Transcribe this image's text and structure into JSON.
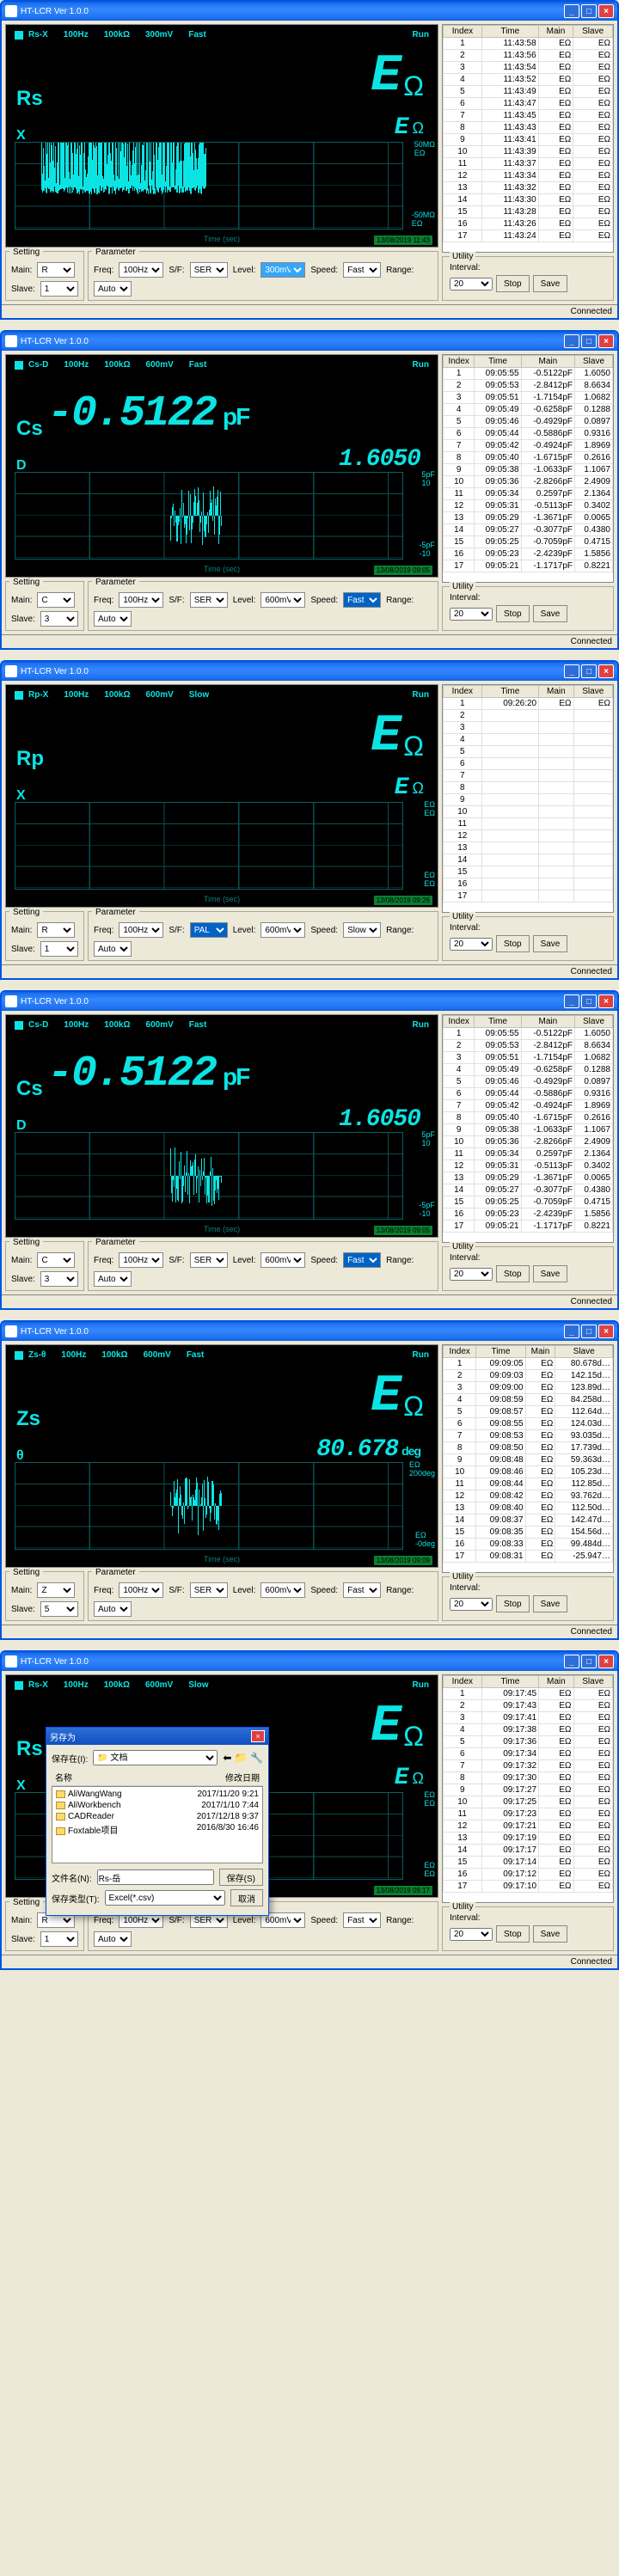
{
  "app_title": "HT-LCR Ver 1.0.0",
  "status_text": "Connected",
  "labels": {
    "setting": "Setting",
    "parameter": "Parameter",
    "utility": "Utility",
    "main": "Main:",
    "slave": "Slave:",
    "freq": "Freq:",
    "sf": "S/F:",
    "level": "Level:",
    "speed": "Speed:",
    "range": "Range:",
    "interval": "Interval:",
    "stop": "Stop",
    "save": "Save",
    "run": "Run",
    "time_axis": "Time (sec)"
  },
  "titlebar_btns": {
    "min": "_",
    "max": "□",
    "close": "×"
  },
  "table_headers": [
    "Index",
    "Time",
    "Main",
    "Slave"
  ],
  "windows": [
    {
      "header": {
        "mode": "Rs-X",
        "freq": "100Hz",
        "imp": "100kΩ",
        "level": "300mV",
        "speed": "Fast"
      },
      "main_label": "Rs",
      "main_value": "E",
      "main_unit": "Ω",
      "sec_label": "X",
      "sec_value": "E",
      "sec_unit": "Ω",
      "y_top": "50MΩ",
      "y_top_sub": "EΩ",
      "y_bot": "-50MΩ",
      "y_bot_sub": "EΩ",
      "ts": "13/08/2019 11:43",
      "noise_dense": true,
      "setting": {
        "main": "R",
        "slave": "1"
      },
      "param": {
        "freq": "100Hz",
        "sf": "SER",
        "level": "300mV",
        "level_hl": true,
        "speed": "Fast",
        "range": "Auto"
      },
      "interval": "20",
      "rows": [
        [
          "1",
          "11:43:58",
          "EΩ",
          "EΩ"
        ],
        [
          "2",
          "11:43:56",
          "EΩ",
          "EΩ"
        ],
        [
          "3",
          "11:43:54",
          "EΩ",
          "EΩ"
        ],
        [
          "4",
          "11:43:52",
          "EΩ",
          "EΩ"
        ],
        [
          "5",
          "11:43:49",
          "EΩ",
          "EΩ"
        ],
        [
          "6",
          "11:43:47",
          "EΩ",
          "EΩ"
        ],
        [
          "7",
          "11:43:45",
          "EΩ",
          "EΩ"
        ],
        [
          "8",
          "11:43:43",
          "EΩ",
          "EΩ"
        ],
        [
          "9",
          "11:43:41",
          "EΩ",
          "EΩ"
        ],
        [
          "10",
          "11:43:39",
          "EΩ",
          "EΩ"
        ],
        [
          "11",
          "11:43:37",
          "EΩ",
          "EΩ"
        ],
        [
          "12",
          "11:43:34",
          "EΩ",
          "EΩ"
        ],
        [
          "13",
          "11:43:32",
          "EΩ",
          "EΩ"
        ],
        [
          "14",
          "11:43:30",
          "EΩ",
          "EΩ"
        ],
        [
          "15",
          "11:43:28",
          "EΩ",
          "EΩ"
        ],
        [
          "16",
          "11:43:26",
          "EΩ",
          "EΩ"
        ],
        [
          "17",
          "11:43:24",
          "EΩ",
          "EΩ"
        ]
      ]
    },
    {
      "header": {
        "mode": "Cs-D",
        "freq": "100Hz",
        "imp": "100kΩ",
        "level": "600mV",
        "speed": "Fast"
      },
      "main_label": "Cs",
      "main_bigvalue": "-0.5122",
      "main_unit": "pF",
      "sec_label": "D",
      "sec_bigvalue": "1.6050",
      "y_top": "5pF",
      "y_top_sub": "10",
      "y_bot": "-5pF",
      "y_bot_sub": "-10",
      "ts": "13/08/2019 09:05",
      "noise_spike": true,
      "setting": {
        "main": "C",
        "slave": "3"
      },
      "param": {
        "freq": "100Hz",
        "sf": "SER",
        "level": "600mV",
        "speed": "Fast",
        "speed_hl": true,
        "range": "Auto"
      },
      "interval": "20",
      "rows": [
        [
          "1",
          "09:05:55",
          "-0.5122pF",
          "1.6050"
        ],
        [
          "2",
          "09:05:53",
          "-2.8412pF",
          "8.6634"
        ],
        [
          "3",
          "09:05:51",
          "-1.7154pF",
          "1.0682"
        ],
        [
          "4",
          "09:05:49",
          "-0.6258pF",
          "0.1288"
        ],
        [
          "5",
          "09:05:46",
          "-0.4929pF",
          "0.0897"
        ],
        [
          "6",
          "09:05:44",
          "-0.5886pF",
          "0.9316"
        ],
        [
          "7",
          "09:05:42",
          "-0.4924pF",
          "1.8969"
        ],
        [
          "8",
          "09:05:40",
          "-1.6715pF",
          "0.2616"
        ],
        [
          "9",
          "09:05:38",
          "-1.0633pF",
          "1.1067"
        ],
        [
          "10",
          "09:05:36",
          "-2.8266pF",
          "2.4909"
        ],
        [
          "11",
          "09:05:34",
          "0.2597pF",
          "2.1364"
        ],
        [
          "12",
          "09:05:31",
          "-0.5113pF",
          "0.3402"
        ],
        [
          "13",
          "09:05:29",
          "-1.3671pF",
          "0.0065"
        ],
        [
          "14",
          "09:05:27",
          "-0.3077pF",
          "0.4380"
        ],
        [
          "15",
          "09:05:25",
          "-0.7059pF",
          "0.4715"
        ],
        [
          "16",
          "09:05:23",
          "-2.4239pF",
          "1.5856"
        ],
        [
          "17",
          "09:05:21",
          "-1.1717pF",
          "0.8221"
        ]
      ]
    },
    {
      "header": {
        "mode": "Rp-X",
        "freq": "100Hz",
        "imp": "100kΩ",
        "level": "600mV",
        "speed": "Slow"
      },
      "main_label": "Rp",
      "main_value": "E",
      "main_unit": "Ω",
      "sec_label": "X",
      "sec_value": "E",
      "sec_unit": "Ω",
      "y_top": "EΩ",
      "y_top_sub": "EΩ",
      "y_bot": "EΩ",
      "y_bot_sub": "EΩ",
      "ts": "13/08/2019 09:26",
      "noise_dense": false,
      "setting": {
        "main": "R",
        "slave": "1"
      },
      "param": {
        "freq": "100Hz",
        "sf": "PAL",
        "sf_hl": true,
        "level": "600mV",
        "speed": "Slow",
        "range": "Auto",
        "range_dropdown": true
      },
      "interval": "20",
      "rows": [
        [
          "1",
          "09:26:20",
          "EΩ",
          "EΩ"
        ],
        [
          "2",
          "",
          "",
          ""
        ],
        [
          "3",
          "",
          "",
          ""
        ],
        [
          "4",
          "",
          "",
          ""
        ],
        [
          "5",
          "",
          "",
          ""
        ],
        [
          "6",
          "",
          "",
          ""
        ],
        [
          "7",
          "",
          "",
          ""
        ],
        [
          "8",
          "",
          "",
          ""
        ],
        [
          "9",
          "",
          "",
          ""
        ],
        [
          "10",
          "",
          "",
          ""
        ],
        [
          "11",
          "",
          "",
          ""
        ],
        [
          "12",
          "",
          "",
          ""
        ],
        [
          "13",
          "",
          "",
          ""
        ],
        [
          "14",
          "",
          "",
          ""
        ],
        [
          "15",
          "",
          "",
          ""
        ],
        [
          "16",
          "",
          "",
          ""
        ],
        [
          "17",
          "",
          "",
          ""
        ]
      ]
    },
    {
      "header": {
        "mode": "Cs-D",
        "freq": "100Hz",
        "imp": "100kΩ",
        "level": "600mV",
        "speed": "Fast"
      },
      "main_label": "Cs",
      "main_bigvalue": "-0.5122",
      "main_unit": "pF",
      "sec_label": "D",
      "sec_bigvalue": "1.6050",
      "y_top": "5pF",
      "y_top_sub": "10",
      "y_bot": "-5pF",
      "y_bot_sub": "-10",
      "ts": "13/08/2019 09:05",
      "noise_spike": true,
      "setting": {
        "main": "C",
        "slave": "3"
      },
      "param": {
        "freq": "100Hz",
        "sf": "SER",
        "level": "600mV",
        "speed": "Fast",
        "speed_hl": true,
        "range": "Auto"
      },
      "interval": "20",
      "rows": [
        [
          "1",
          "09:05:55",
          "-0.5122pF",
          "1.6050"
        ],
        [
          "2",
          "09:05:53",
          "-2.8412pF",
          "8.6634"
        ],
        [
          "3",
          "09:05:51",
          "-1.7154pF",
          "1.0682"
        ],
        [
          "4",
          "09:05:49",
          "-0.6258pF",
          "0.1288"
        ],
        [
          "5",
          "09:05:46",
          "-0.4929pF",
          "0.0897"
        ],
        [
          "6",
          "09:05:44",
          "-0.5886pF",
          "0.9316"
        ],
        [
          "7",
          "09:05:42",
          "-0.4924pF",
          "1.8969"
        ],
        [
          "8",
          "09:05:40",
          "-1.6715pF",
          "0.2616"
        ],
        [
          "9",
          "09:05:38",
          "-1.0633pF",
          "1.1067"
        ],
        [
          "10",
          "09:05:36",
          "-2.8266pF",
          "2.4909"
        ],
        [
          "11",
          "09:05:34",
          "0.2597pF",
          "2.1364"
        ],
        [
          "12",
          "09:05:31",
          "-0.5113pF",
          "0.3402"
        ],
        [
          "13",
          "09:05:29",
          "-1.3671pF",
          "0.0065"
        ],
        [
          "14",
          "09:05:27",
          "-0.3077pF",
          "0.4380"
        ],
        [
          "15",
          "09:05:25",
          "-0.7059pF",
          "0.4715"
        ],
        [
          "16",
          "09:05:23",
          "-2.4239pF",
          "1.5856"
        ],
        [
          "17",
          "09:05:21",
          "-1.1717pF",
          "0.8221"
        ]
      ]
    },
    {
      "header": {
        "mode": "Zs-θ",
        "freq": "100Hz",
        "imp": "100kΩ",
        "level": "600mV",
        "speed": "Fast"
      },
      "main_label": "Zs",
      "main_value": "E",
      "main_unit": "Ω",
      "sec_label": "θ",
      "sec_bigvalue": "80.678",
      "sec_bigunit": "deg",
      "y_top": "EΩ",
      "y_top_sub": "200deg",
      "y_bot": "EΩ",
      "y_bot_sub": "-0deg",
      "ts": "13/08/2019 09:09",
      "noise_spike": true,
      "setting": {
        "main": "Z",
        "slave": "5"
      },
      "param": {
        "freq": "100Hz",
        "sf": "SER",
        "level": "600mV",
        "speed": "Fast",
        "range": "Auto"
      },
      "interval": "20",
      "rows": [
        [
          "1",
          "09:09:05",
          "EΩ",
          "80.678d…"
        ],
        [
          "2",
          "09:09:03",
          "EΩ",
          "142.15d…"
        ],
        [
          "3",
          "09:09:00",
          "EΩ",
          "123.89d…"
        ],
        [
          "4",
          "09:08:59",
          "EΩ",
          "84.258d…"
        ],
        [
          "5",
          "09:08:57",
          "EΩ",
          "112.64d…"
        ],
        [
          "6",
          "09:08:55",
          "EΩ",
          "124.03d…"
        ],
        [
          "7",
          "09:08:53",
          "EΩ",
          "93.035d…"
        ],
        [
          "8",
          "09:08:50",
          "EΩ",
          "17.739d…"
        ],
        [
          "9",
          "09:08:48",
          "EΩ",
          "59.363d…"
        ],
        [
          "10",
          "09:08:46",
          "EΩ",
          "105.23d…"
        ],
        [
          "11",
          "09:08:44",
          "EΩ",
          "112.85d…"
        ],
        [
          "12",
          "09:08:42",
          "EΩ",
          "93.762d…"
        ],
        [
          "13",
          "09:08:40",
          "EΩ",
          "112.50d…"
        ],
        [
          "14",
          "09:08:37",
          "EΩ",
          "142.47d…"
        ],
        [
          "15",
          "09:08:35",
          "EΩ",
          "154.56d…"
        ],
        [
          "16",
          "09:08:33",
          "EΩ",
          "99.484d…"
        ],
        [
          "17",
          "09:08:31",
          "EΩ",
          "-25.947…"
        ]
      ]
    },
    {
      "header": {
        "mode": "Rs-X",
        "freq": "100Hz",
        "imp": "100kΩ",
        "level": "600mV",
        "speed": "Slow"
      },
      "main_label": "Rs",
      "main_value": "E",
      "main_unit": "Ω",
      "sec_label": "X",
      "sec_value": "E",
      "sec_unit": "Ω",
      "y_top": "EΩ",
      "y_top_sub": "EΩ",
      "y_bot": "EΩ",
      "y_bot_sub": "EΩ",
      "ts": "13/08/2019 09:17",
      "noise_dense": false,
      "setting": {
        "main": "R",
        "slave": "1"
      },
      "param": {
        "freq": "100Hz",
        "sf": "SER",
        "level": "600mV",
        "speed": "Fast",
        "range": "Auto"
      },
      "interval": "20",
      "save_dialog": true,
      "rows": [
        [
          "1",
          "09:17:45",
          "EΩ",
          "EΩ"
        ],
        [
          "2",
          "09:17:43",
          "EΩ",
          "EΩ"
        ],
        [
          "3",
          "09:17:41",
          "EΩ",
          "EΩ"
        ],
        [
          "4",
          "09:17:38",
          "EΩ",
          "EΩ"
        ],
        [
          "5",
          "09:17:36",
          "EΩ",
          "EΩ"
        ],
        [
          "6",
          "09:17:34",
          "EΩ",
          "EΩ"
        ],
        [
          "7",
          "09:17:32",
          "EΩ",
          "EΩ"
        ],
        [
          "8",
          "09:17:30",
          "EΩ",
          "EΩ"
        ],
        [
          "9",
          "09:17:27",
          "EΩ",
          "EΩ"
        ],
        [
          "10",
          "09:17:25",
          "EΩ",
          "EΩ"
        ],
        [
          "11",
          "09:17:23",
          "EΩ",
          "EΩ"
        ],
        [
          "12",
          "09:17:21",
          "EΩ",
          "EΩ"
        ],
        [
          "13",
          "09:17:19",
          "EΩ",
          "EΩ"
        ],
        [
          "14",
          "09:17:17",
          "EΩ",
          "EΩ"
        ],
        [
          "15",
          "09:17:14",
          "EΩ",
          "EΩ"
        ],
        [
          "16",
          "09:17:12",
          "EΩ",
          "EΩ"
        ],
        [
          "17",
          "09:17:10",
          "EΩ",
          "EΩ"
        ]
      ]
    }
  ],
  "save_dialog": {
    "title": "另存为",
    "savein_label": "保存在(I):",
    "savein_value": "文档",
    "name_col": "名称",
    "date_col": "修改日期",
    "files": [
      {
        "name": "AliWangWang",
        "date": "2017/11/20 9:21"
      },
      {
        "name": "AliWorkbench",
        "date": "2017/1/10 7:44"
      },
      {
        "name": "CADReader",
        "date": "2017/12/18 9:37"
      },
      {
        "name": "Foxtable项目",
        "date": "2016/8/30 16:46"
      }
    ],
    "filename_label": "文件名(N):",
    "filename_value": "Rs-岳",
    "filetype_label": "保存类型(T):",
    "filetype_value": "Excel(*.csv)",
    "save_btn": "保存(S)",
    "cancel_btn": "取消"
  }
}
